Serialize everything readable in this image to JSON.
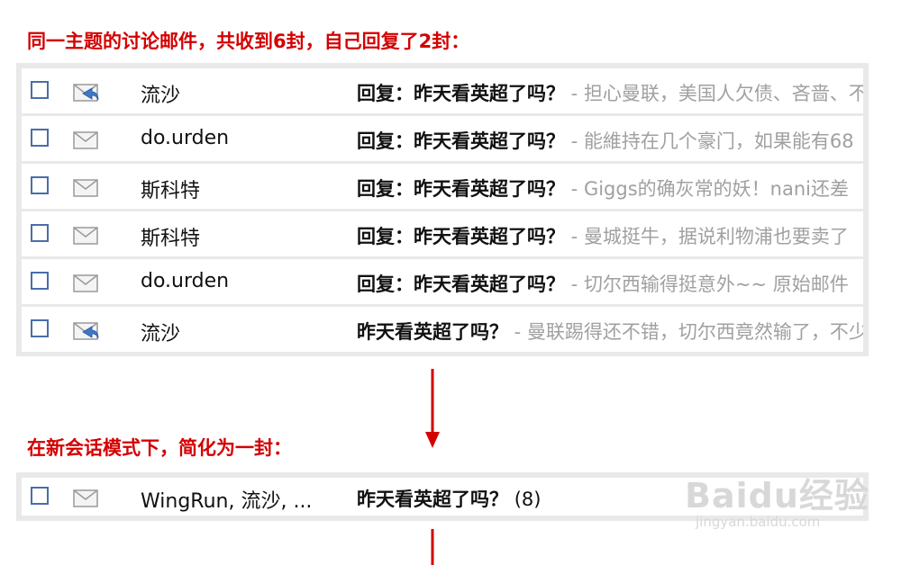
{
  "headings": {
    "top": "同一主题的讨论邮件，共收到6封，自己回复了2封：",
    "middle": "在新会话模式下，简化为一封："
  },
  "mail_list": [
    {
      "sender": "流沙",
      "subject": "回复：昨天看英超了吗？",
      "preview": "担心曼联，美国人欠债、吝啬、不",
      "icon": "reply-envelope-icon"
    },
    {
      "sender": "do.urden",
      "subject": "回复：昨天看英超了吗？",
      "preview": "能維持在几个豪门，如果能有68",
      "icon": "envelope-icon"
    },
    {
      "sender": "斯科特",
      "subject": "回复：昨天看英超了吗？",
      "preview": "Giggs的确灰常的妖！nani还差",
      "icon": "envelope-icon"
    },
    {
      "sender": "斯科特",
      "subject": "回复：昨天看英超了吗？",
      "preview": "曼城挺牛，据说利物浦也要卖了",
      "icon": "envelope-icon"
    },
    {
      "sender": "do.urden",
      "subject": "回复：昨天看英超了吗？",
      "preview": "切尔西输得挺意外~~ 原始邮件",
      "icon": "envelope-icon"
    },
    {
      "sender": "流沙",
      "subject": "昨天看英超了吗？",
      "preview": "曼联踢得还不错，切尔西竟然输了，不少",
      "icon": "reply-envelope-icon"
    }
  ],
  "conversation": {
    "sender": "WingRun, 流沙, ...",
    "subject": "昨天看英超了吗？",
    "count": "(8)",
    "icon": "envelope-icon"
  },
  "separator": " - ",
  "watermark": {
    "logo": "Baidu经验",
    "url": "jingyan.baidu.com"
  },
  "colors": {
    "heading": "#d40000",
    "arrow": "#d40000",
    "checkbox_border": "#4a6ea8",
    "preview_text": "#a0a0a0"
  }
}
